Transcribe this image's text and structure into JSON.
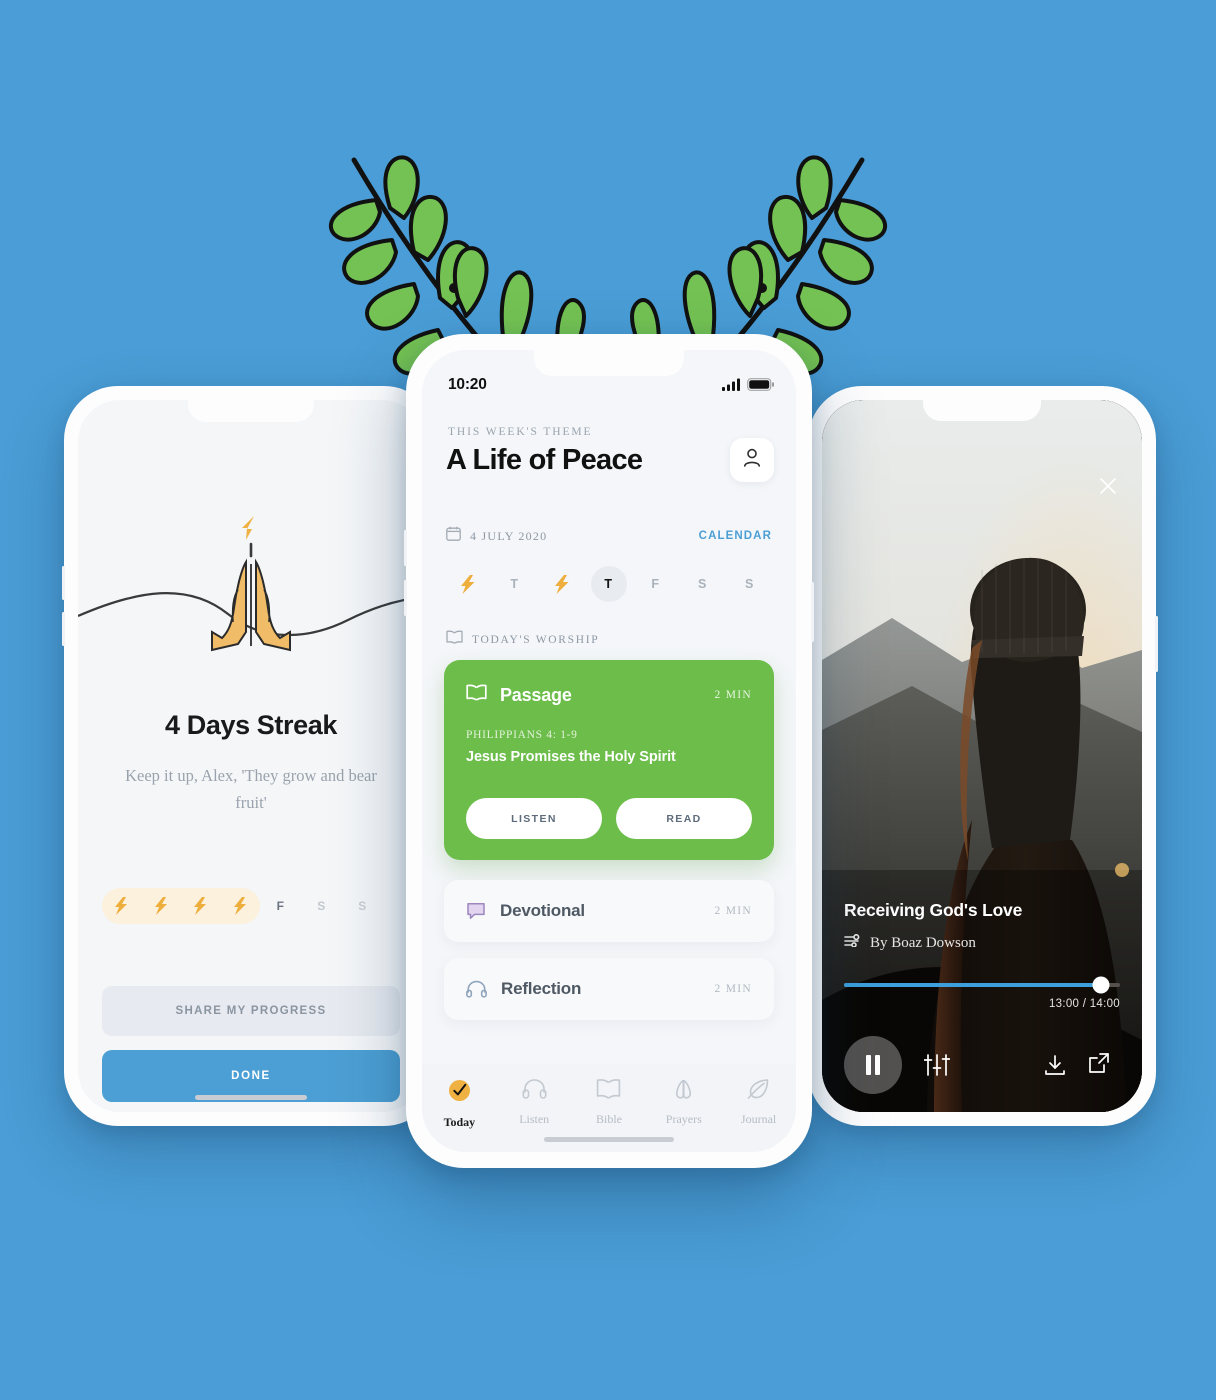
{
  "theme": {
    "background": "#4a9dd6",
    "accent_blue": "#4c9fd4",
    "accent_green": "#6cbd4a",
    "accent_gold": "#efb141",
    "leaf_green": "#74c253"
  },
  "decor": {
    "laurel_icon": "laurel-leaves"
  },
  "left_phone": {
    "name": "streak-screen",
    "illustration_icon": "praying-hands-illustration",
    "bolt_icon": "lightning-bolt-icon",
    "title": "4 Days Streak",
    "subtitle": "Keep it up, Alex, 'They grow and bear fruit'",
    "week": [
      {
        "label": "",
        "icon": "lightning-bolt-icon",
        "done": true
      },
      {
        "label": "",
        "icon": "lightning-bolt-icon",
        "done": true
      },
      {
        "label": "",
        "icon": "lightning-bolt-icon",
        "done": true
      },
      {
        "label": "",
        "icon": "lightning-bolt-icon",
        "done": true
      },
      {
        "label": "F",
        "icon": "",
        "done": false
      },
      {
        "label": "S",
        "icon": "",
        "done": false
      },
      {
        "label": "S",
        "icon": "",
        "done": false
      }
    ],
    "share_label": "SHARE MY PROGRESS",
    "done_label": "DONE"
  },
  "center_phone": {
    "name": "today-screen",
    "status": {
      "time": "10:20",
      "signal_icon": "cellular-signal-icon",
      "battery_icon": "battery-full-icon"
    },
    "header": {
      "eyebrow": "THIS WEEK'S THEME",
      "title": "A Life of Peace",
      "avatar_icon": "person-icon"
    },
    "date_row": {
      "calendar_icon": "calendar-icon",
      "date": "4 JULY 2020",
      "calendar_link": "CALENDAR"
    },
    "week_days": [
      {
        "label": "",
        "icon": "lightning-bolt-icon",
        "active": false
      },
      {
        "label": "T",
        "icon": "",
        "active": false
      },
      {
        "label": "",
        "icon": "lightning-bolt-icon",
        "active": false
      },
      {
        "label": "T",
        "icon": "",
        "active": true
      },
      {
        "label": "F",
        "icon": "",
        "active": false
      },
      {
        "label": "S",
        "icon": "",
        "active": false
      },
      {
        "label": "S",
        "icon": "",
        "active": false
      }
    ],
    "section": {
      "icon": "open-book-icon",
      "label": "TODAY'S WORSHIP"
    },
    "passage_card": {
      "icon": "open-book-icon",
      "title": "Passage",
      "duration": "2 MIN",
      "reference": "PHILIPPIANS 4: 1-9",
      "subtitle": "Jesus Promises the Holy Spirit",
      "listen_label": "LISTEN",
      "read_label": "READ"
    },
    "rows": [
      {
        "icon": "speech-bubble-icon",
        "title": "Devotional",
        "duration": "2 MIN"
      },
      {
        "icon": "headphones-icon",
        "title": "Reflection",
        "duration": "2 MIN"
      }
    ],
    "tabs": [
      {
        "label": "Today",
        "icon": "check-circle-icon",
        "active": true
      },
      {
        "label": "Listen",
        "icon": "headphones-icon",
        "active": false
      },
      {
        "label": "Bible",
        "icon": "open-book-icon",
        "active": false
      },
      {
        "label": "Prayers",
        "icon": "praying-hands-icon",
        "active": false
      },
      {
        "label": "Journal",
        "icon": "feather-pen-icon",
        "active": false
      }
    ]
  },
  "right_phone": {
    "name": "audio-player-screen",
    "close_icon": "close-icon",
    "title": "Receiving God's Love",
    "author_icon": "audio-wave-icon",
    "author": "By Boaz Dowson",
    "progress_percent": 93,
    "time_display": "13:00 / 14:00",
    "pause_icon": "pause-icon",
    "equalizer_icon": "equalizer-icon",
    "download_icon": "download-icon",
    "share_icon": "share-external-icon"
  }
}
